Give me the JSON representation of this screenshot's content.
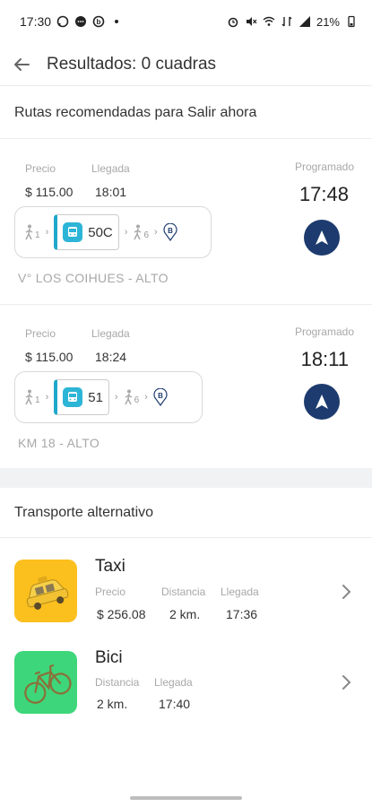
{
  "status_bar": {
    "time": "17:30",
    "battery": "21%",
    "left_icons": [
      "whatsapp-icon",
      "chat-icon",
      "b-app-icon",
      "dot-icon"
    ],
    "right_icons": [
      "alarm-icon",
      "mute-icon",
      "wifi-icon",
      "lte-icon",
      "signal-icon"
    ]
  },
  "header": {
    "title": "Resultados: 0 cuadras",
    "back_icon": "arrow-left-icon"
  },
  "recommended": {
    "header": "Rutas recomendadas para Salir ahora",
    "labels": {
      "price": "Precio",
      "arrival": "Llegada",
      "scheduled": "Programado"
    },
    "routes": [
      {
        "price": "$ 115.00",
        "arrival": "18:01",
        "scheduled_time": "17:48",
        "walk_before": "1",
        "bus_line": "50C",
        "walk_after": "6",
        "destination_badge": "B",
        "route_name": "V° LOS COIHUES - ALTO"
      },
      {
        "price": "$ 115.00",
        "arrival": "18:24",
        "scheduled_time": "18:11",
        "walk_before": "1",
        "bus_line": "51",
        "walk_after": "6",
        "destination_badge": "B",
        "route_name": "KM 18 - ALTO"
      }
    ]
  },
  "alternative": {
    "header": "Transporte alternativo",
    "items": [
      {
        "title": "Taxi",
        "color": "#fbbf1e",
        "fields": [
          {
            "label": "Precio",
            "value": "$ 256.08"
          },
          {
            "label": "Distancia",
            "value": "2 km."
          },
          {
            "label": "Llegada",
            "value": "17:36"
          }
        ]
      },
      {
        "title": "Bici",
        "color": "#3ed67a",
        "fields": [
          {
            "label": "Distancia",
            "value": "2 km."
          },
          {
            "label": "Llegada",
            "value": "17:40"
          }
        ]
      }
    ]
  },
  "colors": {
    "navy": "#1d3b6e",
    "bus_accent": "#1ea8c9",
    "muted": "#a8a8a8"
  }
}
